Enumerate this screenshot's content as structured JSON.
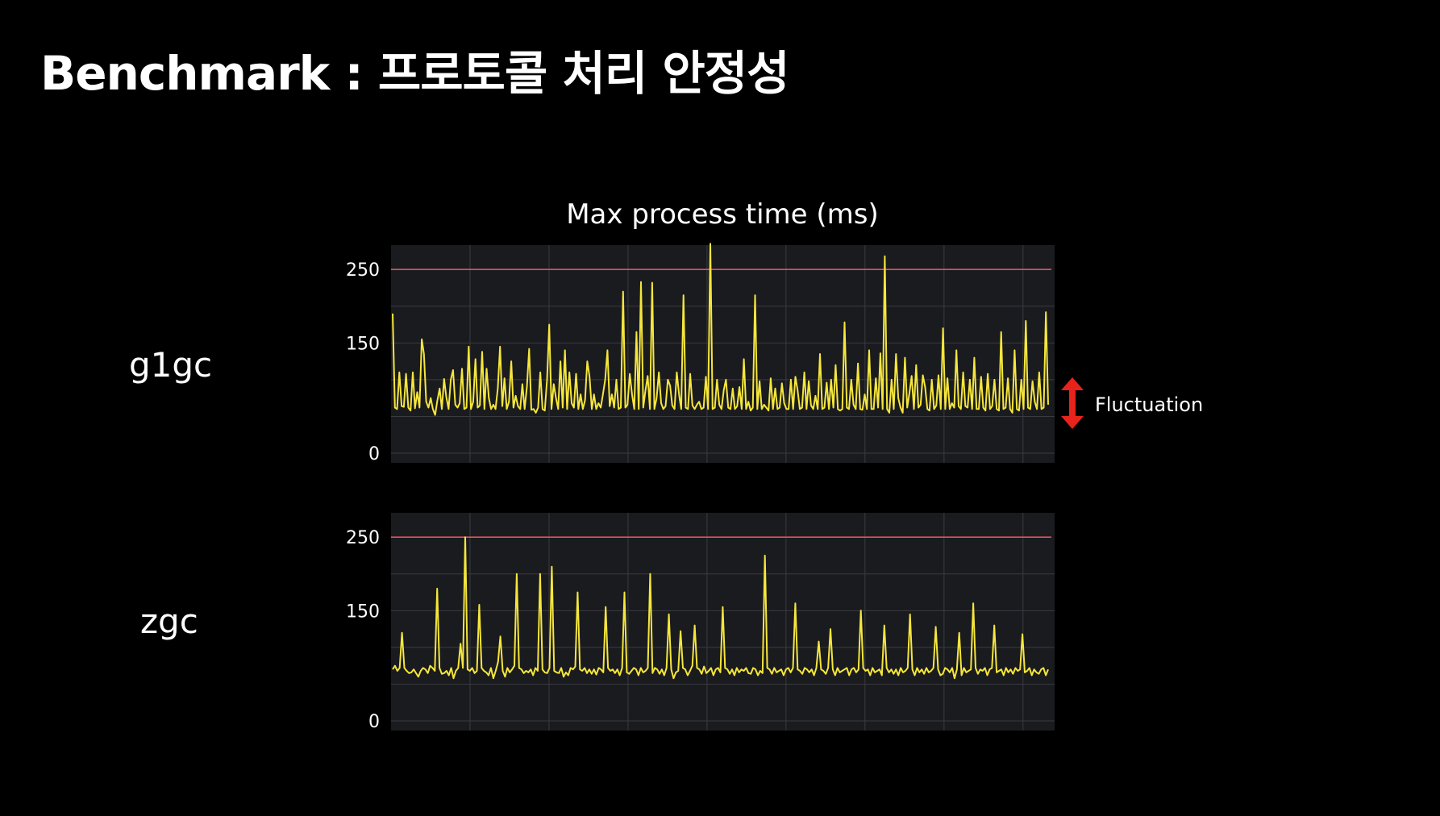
{
  "slide": {
    "title": "Benchmark : 프로토콜 처리 안정성"
  },
  "colors": {
    "background": "#000000",
    "plot_bg": "#1a1b1f",
    "grid": "#3a3b40",
    "line": "#f5e63c",
    "threshold": "#e0525a",
    "arrow": "#e8231c",
    "text": "#ffffff"
  },
  "annotation": {
    "fluctuation_label": "Fluctuation",
    "icon": "double-arrow-vertical-icon"
  },
  "chart_data": [
    {
      "type": "line",
      "title": "Max process time (ms)",
      "row_label": "g1gc",
      "xlabel": "",
      "ylabel": "",
      "ylim": [
        0,
        270
      ],
      "yticks": [
        0,
        150,
        250
      ],
      "ytick_labels": [
        "0",
        "150",
        "250"
      ],
      "threshold": 250,
      "grid": true,
      "series": [
        {
          "values": [
            190,
            62,
            60,
            110,
            64,
            63,
            108,
            62,
            58,
            110,
            61,
            83,
            62,
            155,
            135,
            70,
            62,
            75,
            60,
            52,
            72,
            88,
            60,
            101,
            76,
            60,
            100,
            113,
            66,
            62,
            68,
            115,
            60,
            62,
            145,
            60,
            70,
            128,
            62,
            65,
            138,
            60,
            115,
            75,
            60,
            66,
            60,
            88,
            145,
            64,
            102,
            60,
            70,
            125,
            62,
            78,
            64,
            60,
            94,
            60,
            90,
            142,
            59,
            60,
            55,
            62,
            110,
            60,
            58,
            100,
            175,
            60,
            94,
            75,
            60,
            125,
            62,
            140,
            60,
            110,
            68,
            62,
            108,
            60,
            80,
            60,
            72,
            125,
            104,
            60,
            80,
            60,
            68,
            62,
            80,
            100,
            140,
            64,
            80,
            62,
            100,
            60,
            62,
            220,
            62,
            66,
            108,
            80,
            60,
            165,
            60,
            233,
            62,
            85,
            105,
            60,
            232,
            60,
            75,
            110,
            68,
            60,
            64,
            100,
            92,
            65,
            60,
            110,
            80,
            60,
            215,
            62,
            60,
            108,
            65,
            60,
            66,
            70,
            60,
            62,
            104,
            60,
            285,
            60,
            62,
            100,
            66,
            60,
            86,
            100,
            62,
            60,
            88,
            60,
            64,
            90,
            60,
            128,
            60,
            70,
            58,
            62,
            215,
            60,
            98,
            60,
            66,
            62,
            58,
            102,
            60,
            88,
            60,
            62,
            95,
            68,
            60,
            60,
            100,
            60,
            104,
            86,
            60,
            62,
            110,
            60,
            98,
            65,
            60,
            78,
            60,
            135,
            60,
            62,
            96,
            60,
            100,
            62,
            120,
            60,
            58,
            60,
            178,
            62,
            60,
            100,
            66,
            60,
            122,
            60,
            59,
            80,
            60,
            140,
            60,
            60,
            102,
            62,
            136,
            60,
            268,
            60,
            55,
            100,
            60,
            135,
            75,
            62,
            55,
            130,
            62,
            82,
            105,
            60,
            120,
            62,
            66,
            106,
            90,
            60,
            58,
            100,
            60,
            65,
            106,
            60,
            170,
            60,
            102,
            60,
            68,
            62,
            140,
            64,
            60,
            110,
            64,
            62,
            100,
            60,
            130,
            60,
            60,
            104,
            62,
            58,
            108,
            60,
            64,
            100,
            60,
            58,
            165,
            60,
            62,
            102,
            60,
            55,
            140,
            60,
            58,
            100,
            60,
            180,
            62,
            60,
            98,
            70,
            60,
            110,
            60,
            62,
            192,
            66
          ]
        }
      ]
    },
    {
      "type": "line",
      "title": "",
      "row_label": "zgc",
      "xlabel": "",
      "ylabel": "",
      "ylim": [
        0,
        270
      ],
      "yticks": [
        0,
        150,
        250
      ],
      "ytick_labels": [
        "0",
        "150",
        "250"
      ],
      "threshold": 250,
      "grid": true,
      "series": [
        {
          "values": [
            70,
            75,
            68,
            72,
            120,
            72,
            68,
            65,
            66,
            70,
            65,
            60,
            68,
            72,
            70,
            65,
            75,
            72,
            68,
            180,
            72,
            64,
            65,
            68,
            62,
            72,
            58,
            68,
            72,
            105,
            72,
            250,
            70,
            68,
            72,
            65,
            68,
            158,
            72,
            68,
            66,
            62,
            72,
            58,
            68,
            80,
            115,
            68,
            60,
            72,
            66,
            70,
            75,
            200,
            72,
            70,
            65,
            68,
            66,
            70,
            62,
            72,
            68,
            200,
            70,
            66,
            65,
            72,
            210,
            68,
            66,
            65,
            72,
            60,
            66,
            62,
            72,
            70,
            74,
            175,
            70,
            68,
            72,
            65,
            70,
            64,
            70,
            63,
            72,
            70,
            66,
            155,
            72,
            68,
            70,
            65,
            70,
            62,
            72,
            175,
            66,
            64,
            68,
            72,
            70,
            62,
            72,
            66,
            68,
            72,
            200,
            65,
            72,
            70,
            64,
            70,
            62,
            72,
            145,
            70,
            58,
            66,
            68,
            122,
            72,
            70,
            62,
            68,
            75,
            130,
            72,
            70,
            64,
            74,
            65,
            68,
            72,
            62,
            70,
            72,
            66,
            155,
            72,
            70,
            64,
            70,
            62,
            72,
            66,
            70,
            68,
            72,
            65,
            64,
            72,
            70,
            62,
            68,
            65,
            225,
            72,
            70,
            64,
            72,
            66,
            68,
            70,
            62,
            70,
            72,
            66,
            72,
            160,
            70,
            68,
            64,
            72,
            70,
            66,
            70,
            62,
            72,
            108,
            70,
            68,
            64,
            72,
            125,
            70,
            62,
            72,
            66,
            68,
            70,
            72,
            62,
            70,
            72,
            66,
            70,
            150,
            72,
            68,
            70,
            62,
            72,
            66,
            68,
            70,
            62,
            130,
            72,
            66,
            70,
            64,
            70,
            62,
            72,
            66,
            68,
            72,
            145,
            70,
            62,
            72,
            66,
            70,
            64,
            72,
            66,
            68,
            72,
            128,
            70,
            62,
            64,
            72,
            70,
            66,
            72,
            58,
            70,
            120,
            62,
            72,
            66,
            68,
            70,
            160,
            72,
            64,
            70,
            68,
            72,
            62,
            70,
            72,
            130,
            66,
            68,
            70,
            62,
            72,
            66,
            70,
            64,
            72,
            68,
            70,
            118,
            66,
            68,
            72,
            62,
            70,
            66,
            64,
            70,
            72,
            62,
            70
          ]
        }
      ]
    }
  ]
}
